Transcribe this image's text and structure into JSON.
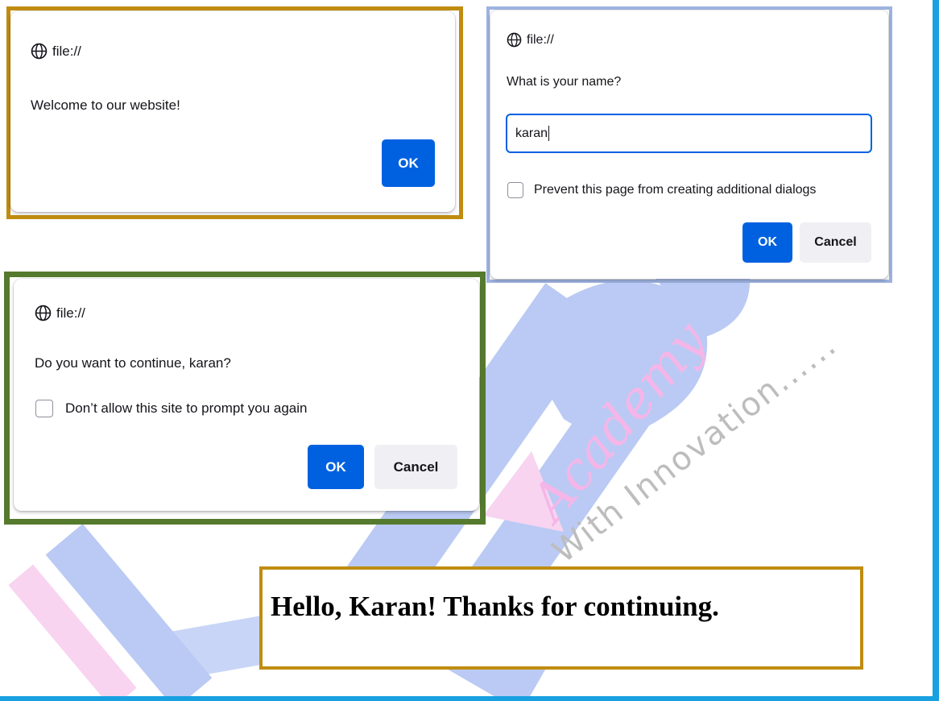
{
  "colors": {
    "accent_blue": "#0061e0",
    "outline_gold": "#c08c10",
    "outline_lightblue": "#9db2e0",
    "outline_green": "#557a2e",
    "frame_blue": "#18a0e0"
  },
  "alert_dialog": {
    "icon": "globe-icon",
    "origin": "file://",
    "message": "Welcome to our website!",
    "ok_label": "OK"
  },
  "prompt_dialog": {
    "icon": "globe-icon",
    "origin": "file://",
    "message": "What is your name?",
    "input_value": "karan",
    "checkbox_checked": false,
    "checkbox_label": "Prevent this page from creating additional dialogs",
    "ok_label": "OK",
    "cancel_label": "Cancel"
  },
  "confirm_dialog": {
    "icon": "globe-icon",
    "origin": "file://",
    "message": "Do you want to continue, karan?",
    "checkbox_checked": false,
    "checkbox_label": "Don’t allow this site to prompt you again",
    "ok_label": "OK",
    "cancel_label": "Cancel"
  },
  "result": {
    "text": "Hello, Karan! Thanks for continuing."
  },
  "watermark": {
    "script_text": "Academy",
    "tagline": "With Innovation......"
  }
}
